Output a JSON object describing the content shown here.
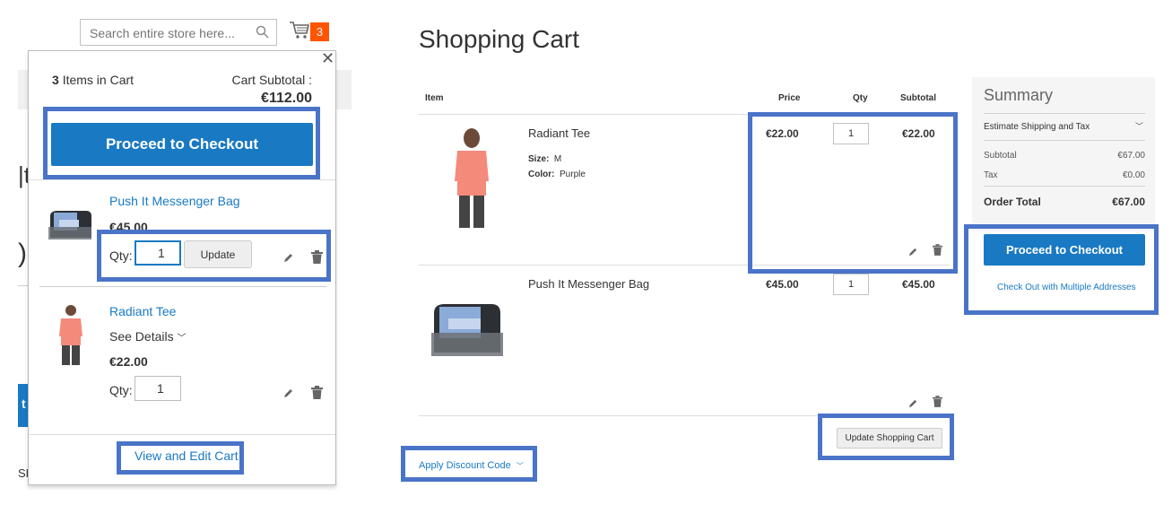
{
  "header": {
    "search_placeholder": "Search entire store here...",
    "cart_count": "3",
    "icons": {
      "search": "magnifier-icon",
      "cart": "shopping-cart-icon"
    }
  },
  "background_fragments": {
    "frag1": "|t",
    "frag2": ")",
    "frag3": "t",
    "frag4": "SH"
  },
  "minicart": {
    "count_number": "3",
    "count_label": "Items in Cart",
    "subtotal_label": "Cart Subtotal :",
    "subtotal_value": "€112.00",
    "checkout_label": "Proceed to Checkout",
    "qty_label": "Qty:",
    "update_label": "Update",
    "see_details_label": "See Details",
    "view_edit_label": "View and Edit Cart",
    "items": [
      {
        "name": "Push It Messenger Bag",
        "price": "€45.00",
        "qty": "1"
      },
      {
        "name": "Radiant Tee",
        "price": "€22.00",
        "qty": "1"
      }
    ]
  },
  "cart": {
    "title": "Shopping Cart",
    "columns": {
      "item": "Item",
      "price": "Price",
      "qty": "Qty",
      "subtotal": "Subtotal"
    },
    "rows": [
      {
        "name": "Radiant Tee",
        "options": [
          {
            "label": "Size:",
            "value": "M"
          },
          {
            "label": "Color:",
            "value": "Purple"
          }
        ],
        "price": "€22.00",
        "qty": "1",
        "subtotal": "€22.00"
      },
      {
        "name": "Push It Messenger Bag",
        "price": "€45.00",
        "qty": "1",
        "subtotal": "€45.00"
      }
    ],
    "update_cart_label": "Update Shopping Cart",
    "discount_label": "Apply Discount Code"
  },
  "summary": {
    "title": "Summary",
    "estimate_label": "Estimate Shipping and Tax",
    "subtotal_label": "Subtotal",
    "subtotal_value": "€67.00",
    "tax_label": "Tax",
    "tax_value": "€0.00",
    "order_total_label": "Order Total",
    "order_total_value": "€67.00",
    "checkout_label": "Proceed to Checkout",
    "multi_label": "Check Out with Multiple Addresses"
  },
  "colors": {
    "accent": "#1979c3",
    "highlight": "#4a74c8",
    "badge": "#ff5501"
  }
}
